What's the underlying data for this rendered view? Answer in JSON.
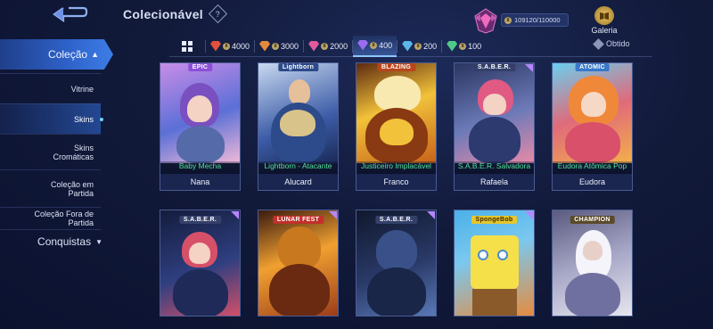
{
  "header": {
    "title": "Colecionável",
    "progress": "109120/110000",
    "gallery_label": "Galeria"
  },
  "sidebar": {
    "main": "Coleção",
    "items": [
      {
        "label": "Vitrine",
        "active": false
      },
      {
        "label": "Skins",
        "active": true
      },
      {
        "label": "Skins Cromáticas",
        "active": false
      },
      {
        "label": "Coleção em Partida",
        "active": false
      },
      {
        "label": "Coleção Fora de Partida",
        "active": false
      }
    ],
    "secondary": "Conquistas"
  },
  "filters": {
    "tabs": [
      {
        "value": "4000",
        "color": "#e0503c",
        "selected": false
      },
      {
        "value": "3000",
        "color": "#e58a3c",
        "selected": false
      },
      {
        "value": "2000",
        "color": "#e05a9c",
        "selected": false
      },
      {
        "value": "400",
        "color": "#9b6cf0",
        "selected": true
      },
      {
        "value": "200",
        "color": "#5ab7e8",
        "selected": false
      },
      {
        "value": "100",
        "color": "#4fc98a",
        "selected": false
      }
    ],
    "obtained_label": "Obtido"
  },
  "cards": [
    {
      "badge": "EPIC",
      "badge_color": "#8c4fd8",
      "skin": "Baby Mecha",
      "hero": "Nana",
      "art": [
        "#c88de8",
        "#5b6fd6",
        "#f0b9d9"
      ]
    },
    {
      "badge": "Lightborn",
      "badge_color": "#2d4a8a",
      "skin": "Lightborn - Atacante",
      "hero": "Alucard",
      "art": [
        "#9ab6e0",
        "#3d5da8",
        "#d8c38a"
      ]
    },
    {
      "badge": "BLAZING",
      "badge_color": "#b8461c",
      "skin": "Justiceiro Implacável",
      "hero": "Franco",
      "art": [
        "#f2c23a",
        "#c6621a",
        "#5c2a10"
      ]
    },
    {
      "badge": "S.A.B.E.R.",
      "badge_color": "#34406a",
      "skin": "S.A.B.E.R. Salvadora",
      "hero": "Rafaela",
      "art": [
        "#e78aa8",
        "#6c7ab8",
        "#2a3560"
      ]
    },
    {
      "badge": "ATOMIC",
      "badge_color": "#3a78c8",
      "skin": "Eudora Atômica Pop",
      "hero": "Eudora",
      "art": [
        "#f3b04a",
        "#e06a7a",
        "#6ad0f0"
      ]
    },
    {
      "badge": "S.A.B.E.R.",
      "badge_color": "#34406a",
      "skin": "",
      "hero": "",
      "art": [
        "#d6506a",
        "#2f3f80",
        "#141c3c"
      ]
    },
    {
      "badge": "LUNAR FEST",
      "badge_color": "#c2302a",
      "skin": "",
      "hero": "",
      "art": [
        "#f0a030",
        "#9a3a1a",
        "#3a1a10"
      ]
    },
    {
      "badge": "S.A.B.E.R.",
      "badge_color": "#34406a",
      "skin": "",
      "hero": "",
      "art": [
        "#5a7ab8",
        "#2a3a68",
        "#10182e"
      ]
    },
    {
      "badge": "SpongeBob",
      "badge_color": "#e6c62a",
      "skin": "",
      "hero": "",
      "art": [
        "#f5e04a",
        "#4ab0e8",
        "#e88a3a"
      ]
    },
    {
      "badge": "CHAMPION",
      "badge_color": "#5a4a2a",
      "skin": "",
      "hero": "",
      "art": [
        "#e8e8f0",
        "#a8a8c8",
        "#5a5a80"
      ]
    }
  ]
}
